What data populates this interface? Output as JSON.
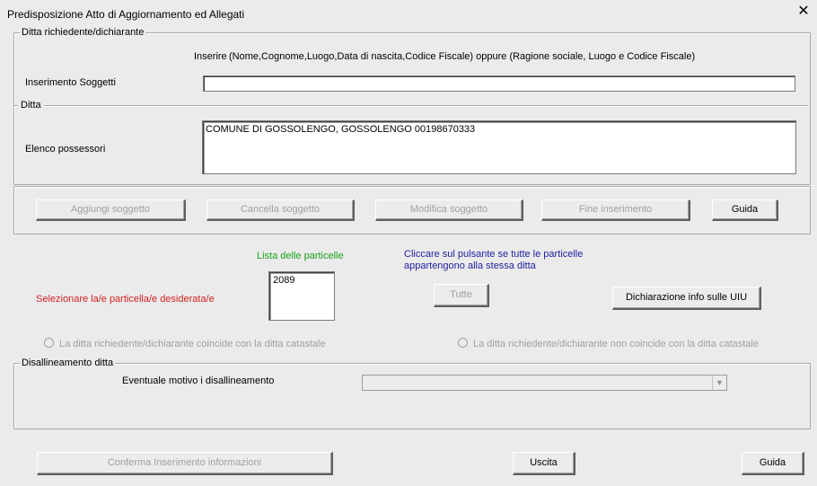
{
  "window": {
    "title": "Predisposizione Atto di Aggiornamento ed Allegati",
    "close_glyph": "✕"
  },
  "ditta_richiedente": {
    "legend": "Ditta richiedente/dichiarante",
    "hint_prefix": "Inserire",
    "hint_text": "(Nome,Cognome,Luogo,Data di nascita,Codice Fiscale) oppure (Ragione sociale, Luogo e Codice Fiscale)",
    "inserimento_label": "Inserimento Soggetti",
    "inserimento_value": ""
  },
  "ditta": {
    "legend": "Ditta",
    "elenco_label": "Elenco possessori",
    "elenco_value": "COMUNE DI GOSSOLENGO, GOSSOLENGO 00198670333"
  },
  "action_buttons": {
    "aggiungi": "Aggiungi soggetto",
    "cancella": "Cancella soggetto",
    "modifica": "Modifica soggetto",
    "fine": "Fine inserimento",
    "guida": "Guida"
  },
  "particelle": {
    "lista_label": "Lista delle particelle",
    "lista_color": "#1aa31a",
    "select_label": "Selezionare la/e particella/e desiderata/e",
    "select_color": "#d42020",
    "items": [
      "2089"
    ],
    "info_line1": "Cliccare sul pulsante se tutte le particelle",
    "info_line2": "appartengono alla stessa ditta",
    "info_color": "#2020a0",
    "tutte_button": "Tutte",
    "dichiarazione_button": "Dichiarazione info sulle UIU"
  },
  "radios": {
    "coincide": "La ditta richiedente/dichiarante coincide con la ditta catastale",
    "non_coincide": "La ditta richiedente/dichiarante non coincide con la ditta catastale"
  },
  "disallineamento": {
    "legend": "Disallineamento ditta",
    "motivo_label": "Eventuale motivo i disallineamento",
    "motivo_value": ""
  },
  "footer": {
    "conferma": "Conferma Inserimento informazioni",
    "uscita": "Uscita",
    "guida": "Guida"
  }
}
